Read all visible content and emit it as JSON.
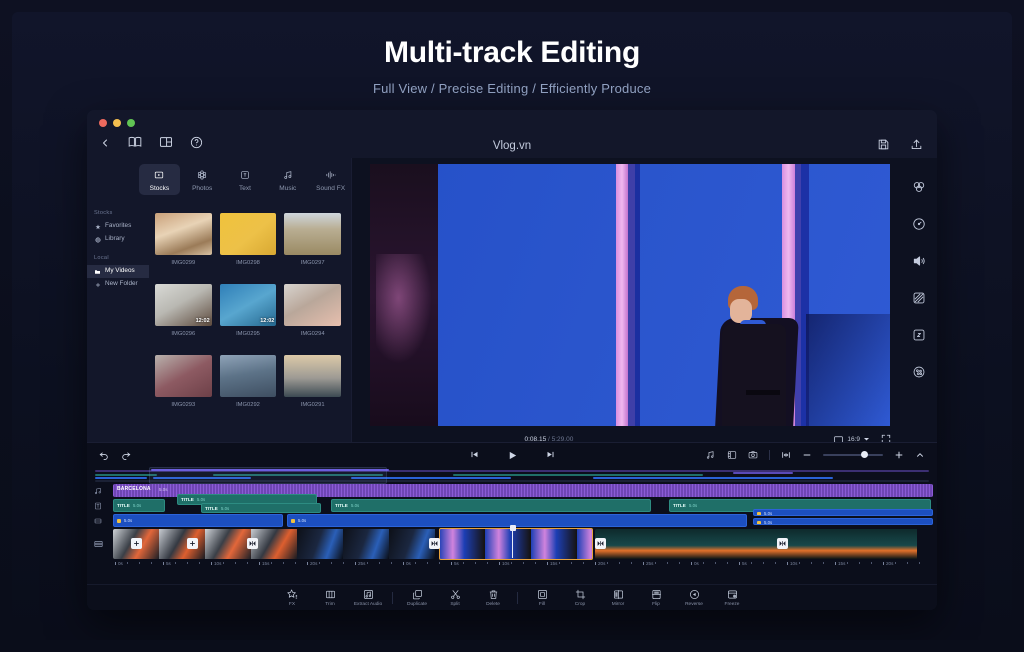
{
  "hero": {
    "title": "Multi-track Editing",
    "subtitle": "Full View / Precise Editing / Efficiently Produce"
  },
  "app": {
    "project_title": "Vlog.vn",
    "titlebar_icons": [
      "back-arrow-icon",
      "book-icon",
      "layout-icon",
      "help-icon"
    ],
    "titlebar_right_icons": [
      "save-icon",
      "export-icon"
    ]
  },
  "library": {
    "tabs": [
      {
        "label": "Stocks",
        "icon": "stocks-icon",
        "active": true
      },
      {
        "label": "Photos",
        "icon": "photos-icon",
        "active": false
      },
      {
        "label": "Text",
        "icon": "text-icon",
        "active": false
      },
      {
        "label": "Music",
        "icon": "music-icon",
        "active": false
      },
      {
        "label": "Sound FX",
        "icon": "soundfx-icon",
        "active": false
      }
    ],
    "nav": {
      "group1_label": "Stocks",
      "group1_items": [
        {
          "label": "Favorites",
          "icon": "star-icon",
          "active": false
        },
        {
          "label": "Library",
          "icon": "globe-icon",
          "active": false
        }
      ],
      "group2_label": "Local",
      "group2_items": [
        {
          "label": "My Videos",
          "icon": "folder-icon",
          "active": true
        },
        {
          "label": "New Folder",
          "icon": "plus-icon",
          "active": false
        }
      ]
    },
    "media": [
      {
        "name": "IMG0299",
        "duration": ""
      },
      {
        "name": "IMG0298",
        "duration": ""
      },
      {
        "name": "IMG0297",
        "duration": ""
      },
      {
        "name": "IMG0296",
        "duration": "12:02"
      },
      {
        "name": "IMG0295",
        "duration": "12:02"
      },
      {
        "name": "IMG0294",
        "duration": ""
      },
      {
        "name": "IMG0293",
        "duration": ""
      },
      {
        "name": "IMG0292",
        "duration": ""
      },
      {
        "name": "IMG0291",
        "duration": ""
      }
    ]
  },
  "preview": {
    "current_time": "0:08.15",
    "total_time": "5:29.00",
    "time_separator": "/",
    "aspect_ratio": "16:9",
    "fullscreen_icon": "fullscreen-icon",
    "rail_icons": [
      "color-icon",
      "speed-icon",
      "volume-icon",
      "mask-icon",
      "transform-icon",
      "effects-icon"
    ]
  },
  "timeline": {
    "undo_label": "undo-icon",
    "redo_label": "redo-icon",
    "transport": [
      "skip-back-icon",
      "play-icon",
      "skip-forward-icon"
    ],
    "tools": [
      "audio-detach-icon",
      "marker-icon",
      "snapshot-icon"
    ],
    "zoom_fit_icon": "zoom-fit-icon",
    "zoom_out_icon": "minus-icon",
    "zoom_in_icon": "plus-icon",
    "collapse_icon": "chevron-up-icon",
    "audio_track": {
      "icon": "music-note-icon",
      "clip_label": "BARCELONA",
      "clip_duration": "5.0s"
    },
    "title_track": {
      "icon": "title-icon",
      "clips": [
        {
          "label": "TITLE",
          "duration": "5.0s"
        },
        {
          "label": "TITLE",
          "duration": "5.0s"
        },
        {
          "label": "TITLE",
          "duration": "5.0s"
        },
        {
          "label": "TITLE",
          "duration": "5.0s"
        },
        {
          "label": "TITLE",
          "duration": "5.0s"
        }
      ]
    },
    "effect_track": {
      "icon": "effect-icon",
      "clips": [
        {
          "duration": "5.0s"
        },
        {
          "duration": "5.0s"
        },
        {
          "duration": "5.0s"
        },
        {
          "duration": "5.0s"
        }
      ]
    },
    "video_track": {
      "icon": "video-icon"
    },
    "ruler_labels": [
      "0s",
      "5s",
      "10s",
      "15s",
      "20s",
      "25s",
      "0s",
      "5s",
      "10s",
      "15s",
      "20s",
      "25s",
      "0s",
      "5s",
      "10s",
      "15s",
      "20s"
    ]
  },
  "bottom_toolbar": {
    "groups": [
      [
        {
          "label": "FX",
          "icon": "fx-icon"
        },
        {
          "label": "Trim",
          "icon": "trim-icon"
        },
        {
          "label": "Extract Audio",
          "icon": "extract-audio-icon"
        }
      ],
      [
        {
          "label": "Duplicate",
          "icon": "duplicate-icon"
        },
        {
          "label": "Split",
          "icon": "split-icon"
        },
        {
          "label": "Delete",
          "icon": "delete-icon"
        }
      ],
      [
        {
          "label": "Fill",
          "icon": "fill-icon"
        },
        {
          "label": "Crop",
          "icon": "crop-icon"
        },
        {
          "label": "Mirror",
          "icon": "mirror-icon"
        },
        {
          "label": "Flip",
          "icon": "flip-icon"
        },
        {
          "label": "Reverse",
          "icon": "reverse-icon"
        },
        {
          "label": "Freeze",
          "icon": "freeze-icon"
        }
      ]
    ]
  },
  "colors": {
    "page_bg": "#0d1020",
    "app_bg": "#13172a",
    "accent_purple": "#8b5bd6",
    "accent_teal": "#1f6f68",
    "accent_blue": "#1c4fc0",
    "selection": "#e8a33c",
    "subtitle": "#93a3c4"
  }
}
